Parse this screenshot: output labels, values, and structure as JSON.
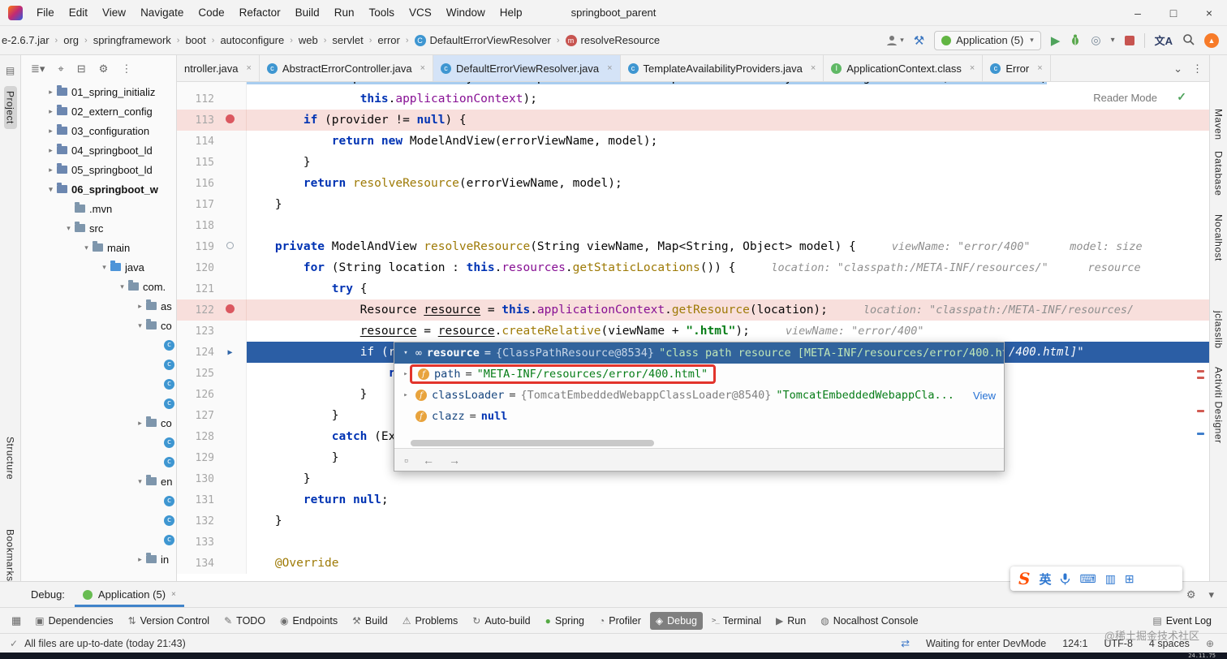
{
  "window": {
    "title": "springboot_parent",
    "controls": {
      "minimize": "–",
      "maximize": "□",
      "close": "×"
    }
  },
  "menu": [
    "File",
    "Edit",
    "View",
    "Navigate",
    "Code",
    "Refactor",
    "Build",
    "Run",
    "Tools",
    "VCS",
    "Window",
    "Help"
  ],
  "breadcrumbs": [
    {
      "label": "e-2.6.7.jar"
    },
    {
      "label": "org"
    },
    {
      "label": "springframework"
    },
    {
      "label": "boot"
    },
    {
      "label": "autoconfigure"
    },
    {
      "label": "web"
    },
    {
      "label": "servlet"
    },
    {
      "label": "error"
    },
    {
      "label": "DefaultErrorViewResolver",
      "icon": "class"
    },
    {
      "label": "resolveResource",
      "icon": "method"
    }
  ],
  "nav": {
    "run_config": "Application (5)",
    "translate": "文A"
  },
  "left_stripe": [
    "Project",
    "Structure",
    "Bookmarks"
  ],
  "right_stripe": [
    "Maven",
    "Database",
    "Nocalhost",
    "jclasslib",
    "Activiti Designer"
  ],
  "project_panel": {
    "tree": [
      {
        "l": "01_spring_initializ",
        "d": 1,
        "c": ">",
        "i": "module"
      },
      {
        "l": "02_extern_config",
        "d": 1,
        "c": ">",
        "i": "module"
      },
      {
        "l": "03_configuration",
        "d": 1,
        "c": ">",
        "i": "module"
      },
      {
        "l": "04_springboot_ld",
        "d": 1,
        "c": ">",
        "i": "module"
      },
      {
        "l": "05_springboot_ld",
        "d": 1,
        "c": ">",
        "i": "module"
      },
      {
        "l": "06_springboot_w",
        "d": 1,
        "c": "v",
        "i": "module",
        "b": true
      },
      {
        "l": ".mvn",
        "d": 2,
        "c": "",
        "i": "folder"
      },
      {
        "l": "src",
        "d": 2,
        "c": "v",
        "i": "folder"
      },
      {
        "l": "main",
        "d": 3,
        "c": "v",
        "i": "folder"
      },
      {
        "l": "java",
        "d": 4,
        "c": "v",
        "i": "src"
      },
      {
        "l": "com.",
        "d": 5,
        "c": "v",
        "i": "package"
      },
      {
        "l": "as",
        "d": 6,
        "c": ">",
        "i": "package"
      },
      {
        "l": "co",
        "d": 6,
        "c": "v",
        "i": "package"
      },
      {
        "l": "",
        "d": 7,
        "c": "",
        "i": "class"
      },
      {
        "l": "",
        "d": 7,
        "c": "",
        "i": "class"
      },
      {
        "l": "",
        "d": 7,
        "c": "",
        "i": "class"
      },
      {
        "l": "",
        "d": 7,
        "c": "",
        "i": "class"
      },
      {
        "l": "co",
        "d": 6,
        "c": ">",
        "i": "package"
      },
      {
        "l": "",
        "d": 7,
        "c": "",
        "i": "class"
      },
      {
        "l": "",
        "d": 7,
        "c": "",
        "i": "class"
      },
      {
        "l": "en",
        "d": 6,
        "c": "v",
        "i": "package"
      },
      {
        "l": "",
        "d": 7,
        "c": "",
        "i": "class"
      },
      {
        "l": "",
        "d": 7,
        "c": "",
        "i": "class"
      },
      {
        "l": "",
        "d": 7,
        "c": "",
        "i": "class"
      },
      {
        "l": "in",
        "d": 6,
        "c": ">",
        "i": "package"
      }
    ]
  },
  "tabs": [
    {
      "label": "ntroller.java",
      "icon": ""
    },
    {
      "label": "AbstractErrorController.java",
      "icon": "class"
    },
    {
      "label": "DefaultErrorViewResolver.java",
      "icon": "class",
      "selected": true
    },
    {
      "label": "TemplateAvailabilityProviders.java",
      "icon": "class"
    },
    {
      "label": "ApplicationContext.class",
      "icon": "interface"
    },
    {
      "label": "Error",
      "icon": "class"
    }
  ],
  "editor": {
    "reader_mode": "Reader Mode",
    "exec_tail": "/400.html]\"",
    "lines": [
      {
        "no": "111",
        "seg": [
          [
            "            TemplateAvailabilityProvider provider = ",
            "sel"
          ],
          [
            "this",
            "sel"
          ],
          [
            ".templateAvailabilityProviders.getProvider(errorViewName,",
            "sel"
          ]
        ]
      },
      {
        "no": "112",
        "seg": [
          [
            "                ",
            "p"
          ],
          [
            "this",
            "k"
          ],
          [
            ".",
            "p"
          ],
          [
            "applicationContext",
            "f"
          ],
          [
            ");",
            "p"
          ]
        ]
      },
      {
        "no": "113",
        "bg": "bp",
        "gut": "bp",
        "seg": [
          [
            "        ",
            "p"
          ],
          [
            "if",
            "k"
          ],
          [
            " (provider != ",
            "p"
          ],
          [
            "null",
            "k"
          ],
          [
            ") {",
            "p"
          ]
        ]
      },
      {
        "no": "114",
        "seg": [
          [
            "            ",
            "p"
          ],
          [
            "return",
            "k"
          ],
          [
            " ",
            "p"
          ],
          [
            "new",
            "k"
          ],
          [
            " ModelAndView(errorViewName, model);",
            "p"
          ]
        ]
      },
      {
        "no": "115",
        "seg": [
          [
            "        }",
            "p"
          ]
        ]
      },
      {
        "no": "116",
        "seg": [
          [
            "        ",
            "p"
          ],
          [
            "return",
            "k"
          ],
          [
            " ",
            "p"
          ],
          [
            "resolveResource",
            "m"
          ],
          [
            "(errorViewName, model);",
            "p"
          ]
        ]
      },
      {
        "no": "117",
        "seg": [
          [
            "    }",
            "p"
          ]
        ]
      },
      {
        "no": "118",
        "seg": []
      },
      {
        "no": "119",
        "gut": "ov",
        "seg": [
          [
            "    ",
            "p"
          ],
          [
            "private",
            "k"
          ],
          [
            " ModelAndView ",
            "p"
          ],
          [
            "resolveResource",
            "m"
          ],
          [
            "(String viewName, Map<String, Object> model) {",
            "p"
          ]
        ],
        "hint": "viewName: \"error/400\"      model: size"
      },
      {
        "no": "120",
        "seg": [
          [
            "        ",
            "p"
          ],
          [
            "for",
            "k"
          ],
          [
            " (String location : ",
            "p"
          ],
          [
            "this",
            "k"
          ],
          [
            ".",
            "p"
          ],
          [
            "resources",
            "f"
          ],
          [
            ".",
            "p"
          ],
          [
            "getStaticLocations",
            "m"
          ],
          [
            "()) {",
            "p"
          ]
        ],
        "hint": "location: \"classpath:/META-INF/resources/\"      resource"
      },
      {
        "no": "121",
        "seg": [
          [
            "            ",
            "p"
          ],
          [
            "try",
            "k"
          ],
          [
            " {",
            "p"
          ]
        ]
      },
      {
        "no": "122",
        "bg": "bp",
        "gut": "bp",
        "seg": [
          [
            "                Resource ",
            "p"
          ],
          [
            "resource",
            "u"
          ],
          [
            " = ",
            "p"
          ],
          [
            "this",
            "k"
          ],
          [
            ".",
            "p"
          ],
          [
            "applicationContext",
            "f"
          ],
          [
            ".",
            "p"
          ],
          [
            "getResource",
            "m"
          ],
          [
            "(location);",
            "p"
          ]
        ],
        "hint": "location: \"classpath:/META-INF/resources/"
      },
      {
        "no": "123",
        "seg": [
          [
            "                ",
            "p"
          ],
          [
            "resource",
            "u"
          ],
          [
            " = ",
            "p"
          ],
          [
            "resource",
            "u"
          ],
          [
            ".",
            "p"
          ],
          [
            "createRelative",
            "m"
          ],
          [
            "(viewName + ",
            "p"
          ],
          [
            "\".html\"",
            "s"
          ],
          [
            ");",
            "p"
          ]
        ],
        "hint": "viewName: \"error/400\""
      },
      {
        "no": "124",
        "bg": "exec",
        "gut": "exec",
        "seg": [
          [
            "                ",
            "p"
          ],
          [
            "if",
            "k"
          ],
          [
            " (resource.exists()) {",
            "p"
          ]
        ]
      },
      {
        "no": "125",
        "seg": [
          [
            "                    ",
            "p"
          ],
          [
            "return",
            "k"
          ],
          [
            " ",
            "p"
          ],
          [
            "new",
            "k"
          ],
          [
            " ModelAndView(",
            "p"
          ],
          [
            "new",
            "k"
          ],
          [
            " HtmlResourceView(resource), model);",
            "p"
          ]
        ]
      },
      {
        "no": "126",
        "seg": [
          [
            "                }",
            "p"
          ]
        ]
      },
      {
        "no": "127",
        "seg": [
          [
            "            }",
            "p"
          ]
        ]
      },
      {
        "no": "128",
        "seg": [
          [
            "            ",
            "p"
          ],
          [
            "catch",
            "k"
          ],
          [
            " (Exception ex) {",
            "p"
          ]
        ]
      },
      {
        "no": "129",
        "seg": [
          [
            "            }",
            "p"
          ]
        ]
      },
      {
        "no": "130",
        "seg": [
          [
            "        }",
            "p"
          ]
        ]
      },
      {
        "no": "131",
        "seg": [
          [
            "        ",
            "p"
          ],
          [
            "return",
            "k"
          ],
          [
            " ",
            "p"
          ],
          [
            "null",
            "k"
          ],
          [
            ";",
            "p"
          ]
        ]
      },
      {
        "no": "132",
        "seg": [
          [
            "    }",
            "p"
          ]
        ]
      },
      {
        "no": "133",
        "seg": []
      },
      {
        "no": "134",
        "seg": [
          [
            "    ",
            "p"
          ],
          [
            "@Override",
            "a"
          ]
        ]
      }
    ]
  },
  "debug_popup": {
    "header": {
      "name": "resource",
      "eq": "=",
      "ref": "{ClassPathResource@8534}",
      "str": "\"class path resource [META-INF/resources/error/400.html]\""
    },
    "rows": [
      {
        "chev": true,
        "icon": "f",
        "name": "path",
        "str": "\"META-INF/resources/error/400.html\"",
        "boxed": true
      },
      {
        "chev": true,
        "icon": "f",
        "name": "classLoader",
        "ref": "{TomcatEmbeddedWebappClassLoader@8540}",
        "str": "\"TomcatEmbeddedWebappCla...",
        "link": "View"
      },
      {
        "chev": false,
        "icon": "f",
        "name": "clazz",
        "kw": "null"
      }
    ]
  },
  "debug_bar": {
    "label": "Debug:",
    "tab": "Application (5)"
  },
  "bottom_bar": {
    "items": [
      {
        "label": "Dependencies",
        "icon": "dep"
      },
      {
        "label": "Version Control",
        "icon": "vcs"
      },
      {
        "label": "TODO",
        "icon": "todo"
      },
      {
        "label": "Endpoints",
        "icon": "endpoints"
      },
      {
        "label": "Build",
        "icon": "build"
      },
      {
        "label": "Problems",
        "icon": "problems"
      },
      {
        "label": "Auto-build",
        "icon": "autobuild"
      },
      {
        "label": "Spring",
        "icon": "spring"
      },
      {
        "label": "Profiler",
        "icon": "profiler"
      },
      {
        "label": "Debug",
        "icon": "debug",
        "selected": true
      },
      {
        "label": "Terminal",
        "icon": "terminal"
      },
      {
        "label": "Run",
        "icon": "run"
      },
      {
        "label": "Nocalhost Console",
        "icon": "nocalhost"
      },
      {
        "label": "Event Log",
        "icon": "eventlog",
        "right": true
      }
    ],
    "watermark": "@稀土掘金技术社区"
  },
  "status_bar": {
    "left": "All files are up-to-date (today 21:43)",
    "devmode": "Waiting for enter DevMode",
    "caret": "124:1",
    "encoding": "UTF-8",
    "indent": "4 spaces"
  },
  "taskbar": {
    "clock": "24.11.75"
  },
  "ime": {
    "logo": "S",
    "lang": "英"
  }
}
